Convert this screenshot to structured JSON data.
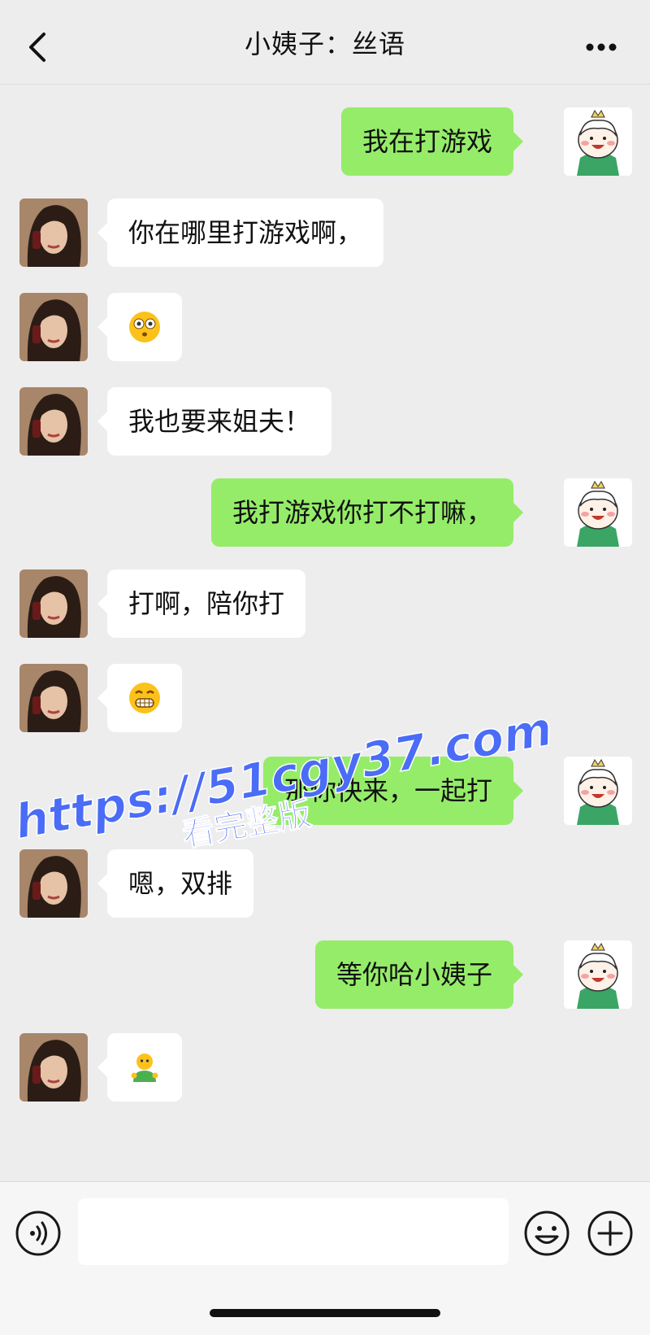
{
  "header": {
    "title": "小姨子：丝语",
    "back_icon": "chevron-left-icon",
    "more_icon": "more-dots-icon"
  },
  "messages": [
    {
      "side": "right",
      "type": "text",
      "text": "我在打游戏"
    },
    {
      "side": "left",
      "type": "text",
      "text": "你在哪里打游戏啊，"
    },
    {
      "side": "left",
      "type": "emoji",
      "emoji": "flushed-face-emoji"
    },
    {
      "side": "left",
      "type": "text",
      "text": "我也要来姐夫！"
    },
    {
      "side": "right",
      "type": "text",
      "text": "我打游戏你打不打嘛，"
    },
    {
      "side": "left",
      "type": "text",
      "text": "打啊，陪你打"
    },
    {
      "side": "left",
      "type": "emoji",
      "emoji": "grimacing-face-emoji"
    },
    {
      "side": "right",
      "type": "text",
      "text": "那你快来，一起打"
    },
    {
      "side": "left",
      "type": "text",
      "text": "嗯，双排"
    },
    {
      "side": "right",
      "type": "text",
      "text": "等你哈小姨子"
    },
    {
      "side": "left",
      "type": "emoji",
      "emoji": "green-shirt-person-emoji"
    }
  ],
  "watermark": {
    "line1": "https://51cgy37.com",
    "line2": "看完整版",
    "color": "#4a6cf7"
  },
  "input_bar": {
    "voice_icon": "voice-icon",
    "emoji_icon": "smiley-icon",
    "plus_icon": "plus-icon",
    "input_value": ""
  },
  "colors": {
    "background": "#ededed",
    "sent_bubble": "#95ec69",
    "received_bubble": "#ffffff"
  }
}
